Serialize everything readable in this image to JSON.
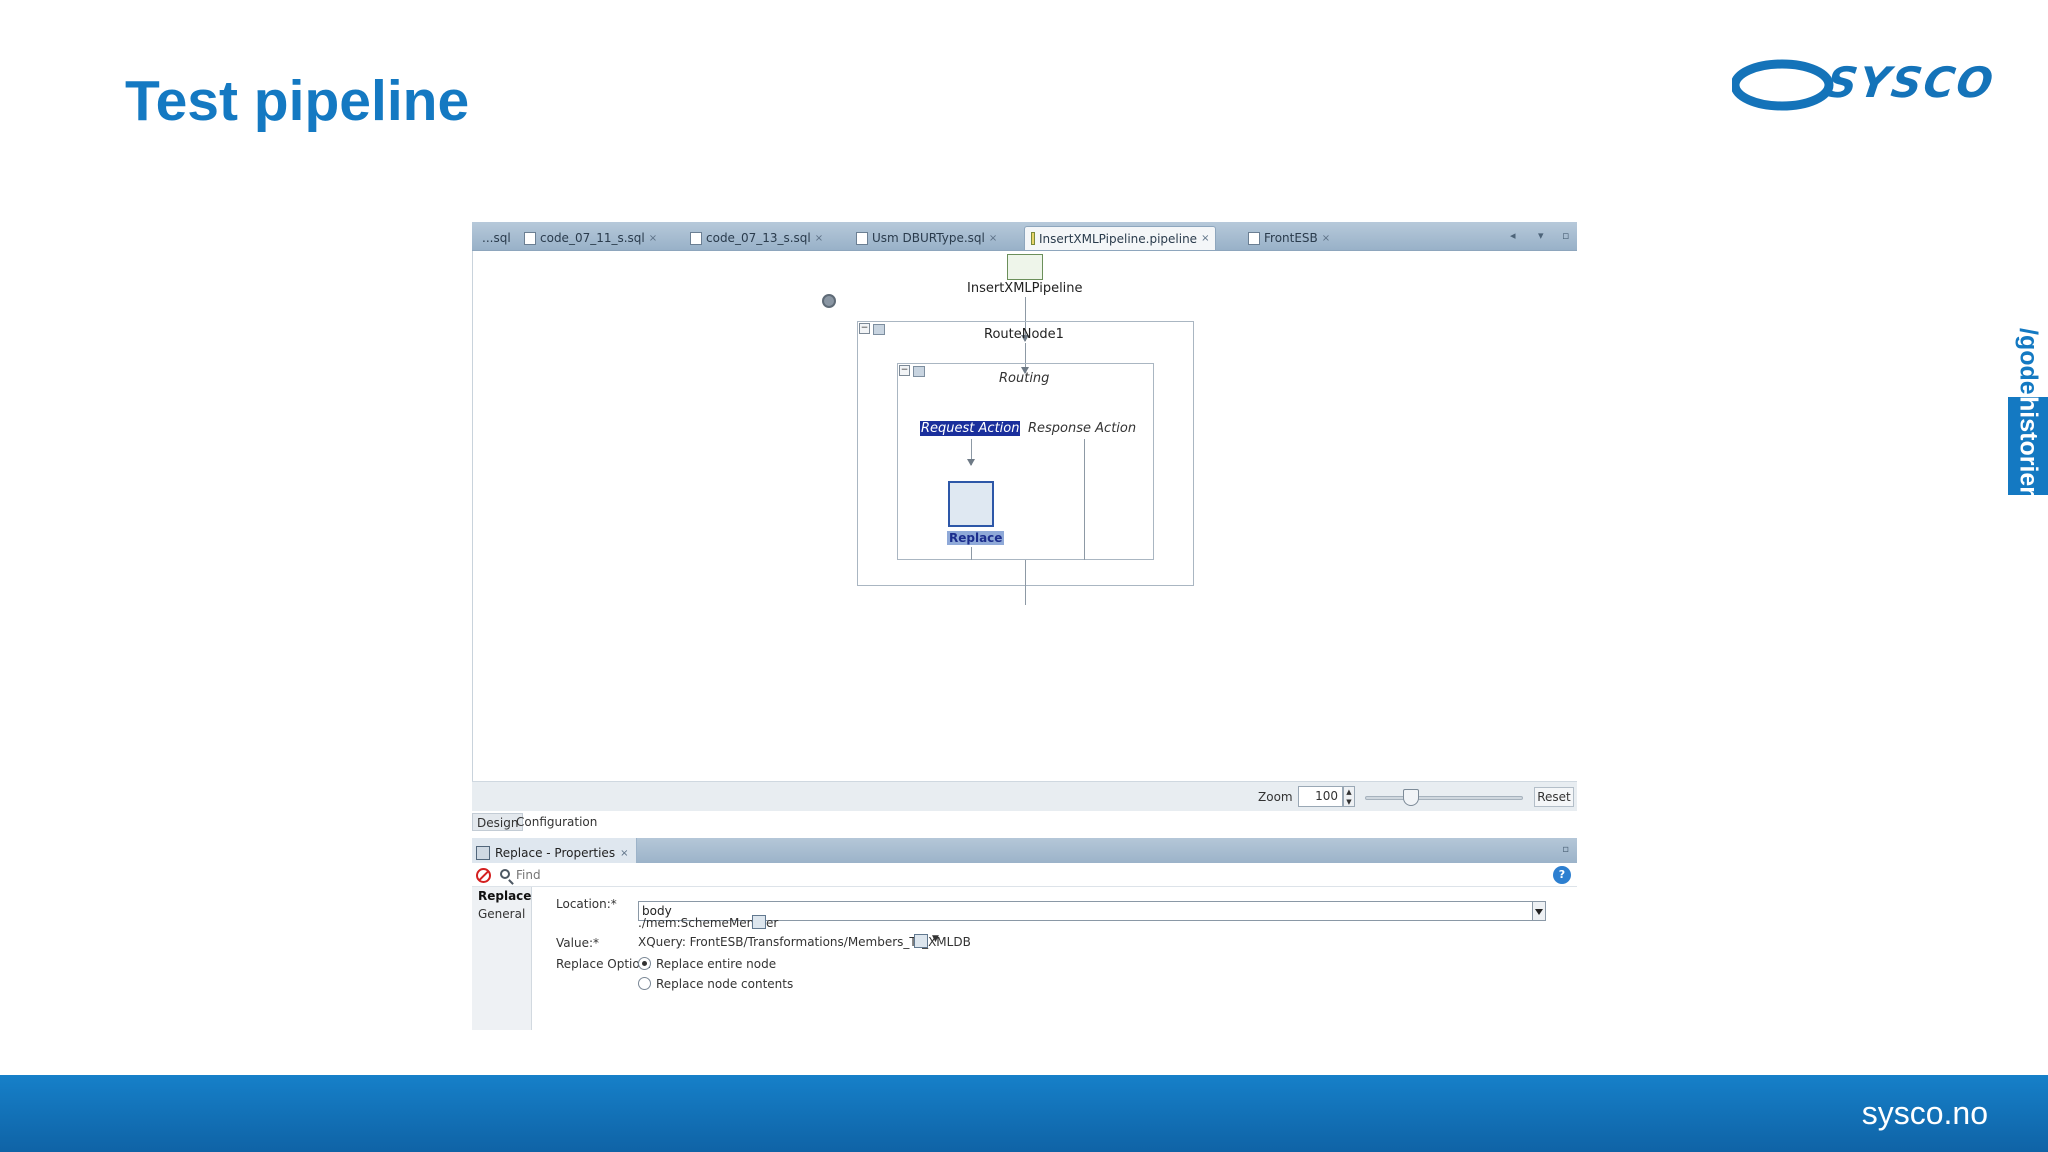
{
  "slide": {
    "title": "Test pipeline",
    "logo_text": "SYSCO",
    "side_tab": {
      "line1": "/gode",
      "line2": "historier"
    },
    "footer_url": "sysco.no",
    "colors": {
      "brand_blue": "#1479c2",
      "footer_blue": "#0f63a6"
    }
  },
  "ide": {
    "tabs": [
      {
        "label": "...sql"
      },
      {
        "label": "code_07_11_s.sql"
      },
      {
        "label": "code_07_13_s.sql"
      },
      {
        "label": "Usm DBURType.sql"
      },
      {
        "label": "InsertXMLPipeline.pipeline",
        "active": true
      },
      {
        "label": "FrontESB"
      }
    ],
    "pipeline": {
      "start_node": "InsertXMLPipeline",
      "route_node": "RouteNode1",
      "routing": "Routing",
      "request_action": "Request Action",
      "response_action": "Response Action",
      "replace_action": "Replace"
    },
    "zoom": {
      "label": "Zoom",
      "value": "100",
      "level_percent": 100,
      "reset": "Reset"
    },
    "editor_tabs": [
      {
        "label": "Design",
        "selected": true
      },
      {
        "label": "Configuration"
      }
    ],
    "properties": {
      "title": "Replace - Properties",
      "find_placeholder": "Find",
      "nav": [
        "Replace",
        "General"
      ],
      "location_label": "Location:*",
      "location_value": "body",
      "location_xpath": "./mem:SchemeMember",
      "value_label": "Value:*",
      "value_text": "XQuery: FrontESB/Transformations/Members_To_XMLDB",
      "option_label": "Replace Option:",
      "options": [
        {
          "label": "Replace entire node",
          "checked": true
        },
        {
          "label": "Replace node contents",
          "checked": false
        }
      ]
    }
  }
}
